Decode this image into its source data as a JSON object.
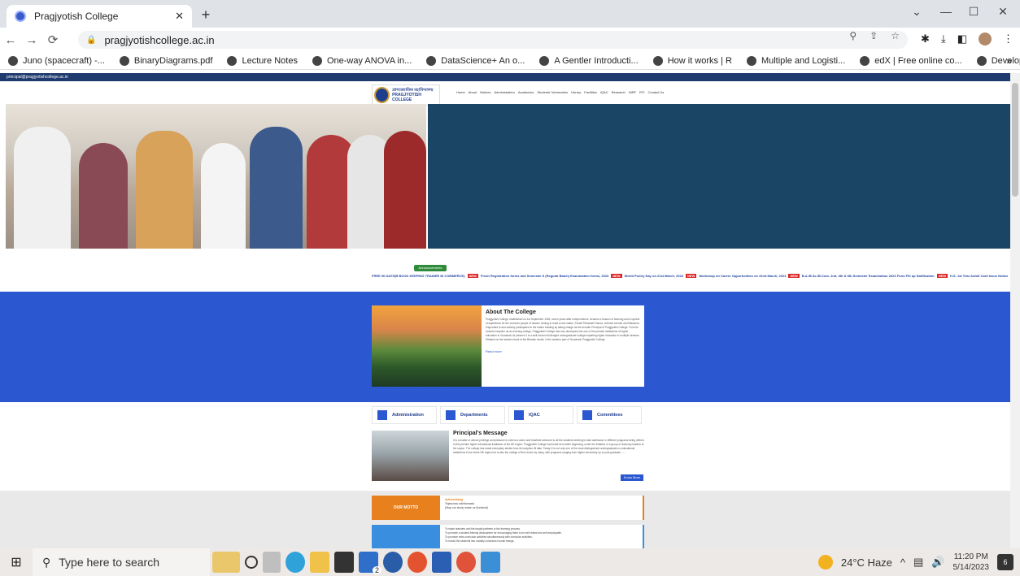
{
  "browser": {
    "tab_title": "Pragjyotish College",
    "url": "pragjyotishcollege.ac.in",
    "bookmarks": [
      "Juno (spacecraft) -...",
      "BinaryDiagrams.pdf",
      "Lecture Notes",
      "One-way ANOVA in...",
      "DataScience+ An o...",
      "A Gentler Introducti...",
      "How it works | R",
      "Multiple and Logisti...",
      "edX | Free online co...",
      "Developing Scalabl..."
    ],
    "bookmarks_more": "»"
  },
  "site": {
    "top_email": "principal@pragjyotishcollege.ac.in",
    "logo_assamese": "প্ৰাগজ্যোতিষ মহাবিদ্যালয়",
    "logo_english": "PRAGJYOTISH COLLEGE",
    "nav": [
      "Home",
      "About",
      "Notices",
      "Administration",
      "Academics",
      "Students' Information",
      "Library",
      "Facilities",
      "IQAC",
      "Research",
      "NIRF",
      "RTI",
      "Contact Us"
    ],
    "announcements_label": "Announcements",
    "ticker": [
      "FREE 06 DAYS(B BOOK KEEPING TRAINEE IN COMMERCE)",
      "Fresh Registration forms and Semester II (Regular Batch) Examination forms, 2023",
      "World Poetry Day on 21st March, 2023",
      "Workshop on Career Opportunities on 22nd March, 2023",
      "B.A./B.Sc./B.Com. 2nd, 4th & 6th Semester Examination 2023 Form Fill up Notification",
      "H.S. 1st Year Admit Card Issue Notice",
      "Examination"
    ],
    "new_badge": "NEW",
    "about_title": "About The College",
    "about_text": "Pragjyotish College, established on 1st September 1954, seven years after independence, became a beacon of learning and a symbol of aspirations for the common people of Assam. Aiming to build a new nation, Pandit Tirthanath Sarma, eminent scholar and litterateur, responded to and actively participated in the nation building by taking charge as the founder Principal of Pragjyotish College. From its modest inception as an evening college, Pragjyotish College has now developed into one of the premier institutions of higher education in Guwahati. At present, it is a well-known full-fledged undergraduate college imparting higher education in multiple streams.",
    "about_text2": "Situated on the western bank of the Bharalu rivulet, in the western part of Guwahati, Pragjyotish College",
    "about_more": "Read more",
    "quick_links": [
      "Administration",
      "Departments",
      "IQAC",
      "Committees"
    ],
    "principal_title": "Principal's Message",
    "principal_text": "It is a matter of utmost privilege and pleasure to extend a warm and heartiest welcome to all the students desiring to take admission in different programs being offered in this premier higher educational institution of the NE region. Pragjyotish College had made its humble beginning, under the initiative of a group of visionary leaders of the region. The college has made exemplary strides from its inception till date. Today, it is not only one of the most distinguished undergraduate co-educational institutions in the entire NE region but is also the college of first choice by many, with programs ranging from higher secondary up to post graduate.......",
    "principal_more": "Know More",
    "motto_label": "OUR MOTTO",
    "motto_title": "Adhivedhang",
    "motto_line1": "Tejasvinav adhitamastu",
    "motto_line2": "(May our study make us illumined)",
    "vision_points": [
      "To make teachers and the taught partners in the learning process.",
      "To promote a student-friendly atmosphere for encouraging them to be self-reliant and self-employable.",
      "To promote extra-curricular activities simultaneously with curricular activities.",
      "To mould the students into socially conscious human beings."
    ]
  },
  "taskbar": {
    "search_placeholder": "Type here to search",
    "weather": "24°C Haze",
    "time": "11:20 PM",
    "date": "5/14/2023",
    "notifications": "6",
    "mail_badge": "2"
  }
}
